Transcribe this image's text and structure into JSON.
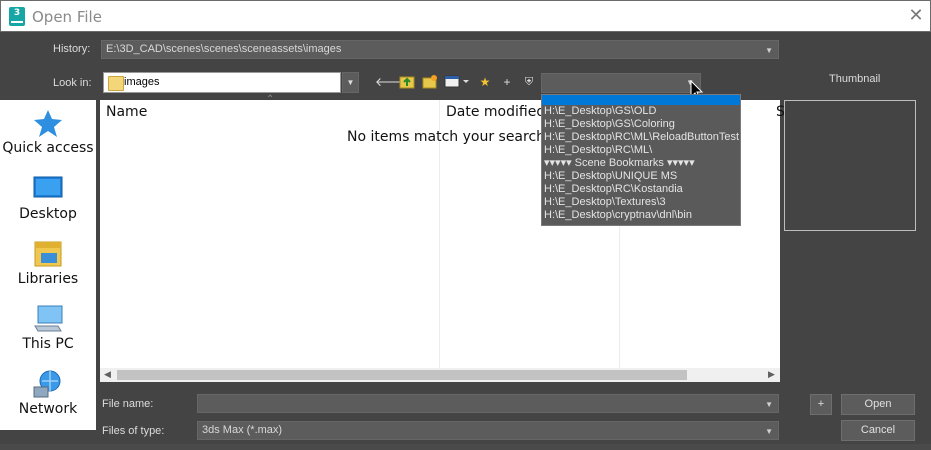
{
  "window": {
    "title": "Open File",
    "app_icon_text": "3"
  },
  "history": {
    "label": "History:",
    "value": "E:\\3D_CAD\\scenes\\scenes\\sceneassets\\images"
  },
  "lookin": {
    "label": "Look in:",
    "value": "images"
  },
  "thumbnail": {
    "label": "Thumbnail"
  },
  "places": [
    {
      "label": "Quick access",
      "icon": "star-icon"
    },
    {
      "label": "Desktop",
      "icon": "desktop-icon"
    },
    {
      "label": "Libraries",
      "icon": "libraries-icon"
    },
    {
      "label": "This PC",
      "icon": "computer-icon"
    },
    {
      "label": "Network",
      "icon": "network-icon"
    }
  ],
  "filelist": {
    "columns": [
      "Name",
      "Date modified",
      "S"
    ],
    "empty_message": "No items match your search."
  },
  "bookmarks_popup": {
    "items": [
      "H:\\E_Desktop\\GS\\OLD",
      "H:\\E_Desktop\\GS\\Coloring",
      "H:\\E_Desktop\\RC\\ML\\ReloadButtonTest",
      "H:\\E_Desktop\\RC\\ML\\",
      "▾▾▾▾▾ Scene Bookmarks ▾▾▾▾▾",
      "H:\\E_Desktop\\UNIQUE MS",
      "H:\\E_Desktop\\RC\\Kostandia",
      "H:\\E_Desktop\\Textures\\3",
      "H:\\E_Desktop\\cryptnav\\dnl\\bin"
    ]
  },
  "filename": {
    "label": "File name:",
    "value": ""
  },
  "filetype": {
    "label": "Files of type:",
    "value": "3ds Max (*.max)"
  },
  "buttons": {
    "plus": "+",
    "open": "Open",
    "cancel": "Cancel"
  },
  "toolbar": {
    "add": "+"
  },
  "colors": {
    "dialog_bg": "#444444",
    "field_bg": "#5c5c5c",
    "selection": "#0078d7",
    "accent_icon": "#16a6a6"
  }
}
